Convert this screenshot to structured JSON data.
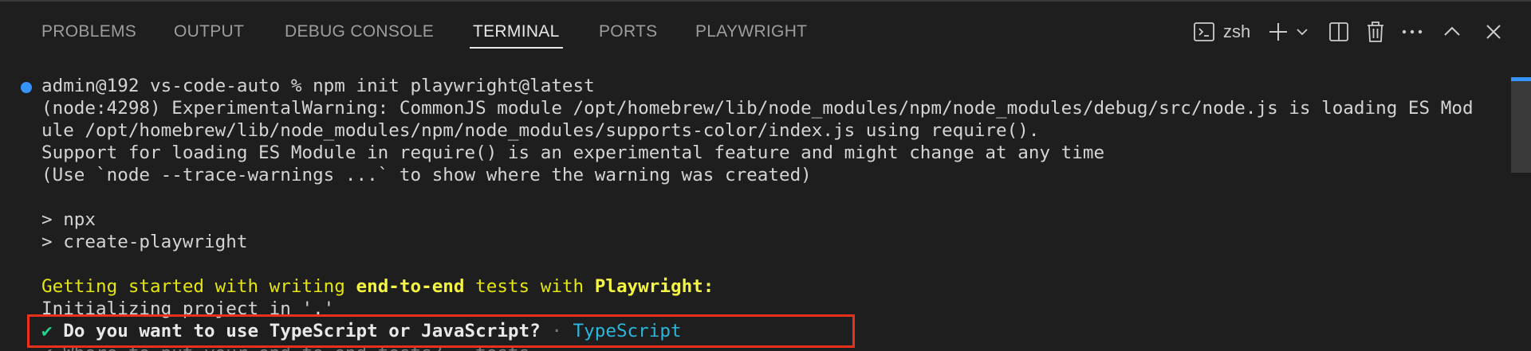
{
  "tabs": [
    {
      "label": "PROBLEMS",
      "active": false
    },
    {
      "label": "OUTPUT",
      "active": false
    },
    {
      "label": "DEBUG CONSOLE",
      "active": false
    },
    {
      "label": "TERMINAL",
      "active": true
    },
    {
      "label": "PORTS",
      "active": false
    },
    {
      "label": "PLAYWRIGHT",
      "active": false
    }
  ],
  "toolbar": {
    "shell_label": "zsh",
    "icons": [
      "terminal-icon",
      "plus-icon",
      "chevron-down-icon",
      "split-icon",
      "trash-icon",
      "ellipsis-icon",
      "chevron-up-icon",
      "close-icon"
    ]
  },
  "terminal": {
    "prompt": "admin@192 vs-code-auto % npm init playwright@latest",
    "warning_line1": "(node:4298) ExperimentalWarning: CommonJS module /opt/homebrew/lib/node_modules/npm/node_modules/debug/src/node.js is loading ES Mod",
    "warning_line2": "ule /opt/homebrew/lib/node_modules/npm/node_modules/supports-color/index.js using require().",
    "warning_line3": "Support for loading ES Module in require() is an experimental feature and might change at any time",
    "warning_line4": "(Use `node --trace-warnings ...` to show where the warning was created)",
    "npx_line1": "> npx",
    "npx_line2": "> create-playwright",
    "getting_started": {
      "part1": "Getting started with writing ",
      "part2": "end-to-end",
      "part3": " tests with ",
      "part4": "Playwright:"
    },
    "initializing": "Initializing project in '.'",
    "question": {
      "check": "✔",
      "text": " Do you want to use TypeScript or JavaScript?",
      "separator": " · ",
      "answer": "TypeScript"
    },
    "next_question_partial": "✔ Where to put your end-to-end tests? · tests"
  },
  "colors": {
    "background": "#1e1e1e",
    "accent_blue": "#3794ff",
    "highlight_red": "#e8311c",
    "yellow": "#e5e510",
    "green": "#23d18b",
    "cyan": "#29b8db"
  }
}
